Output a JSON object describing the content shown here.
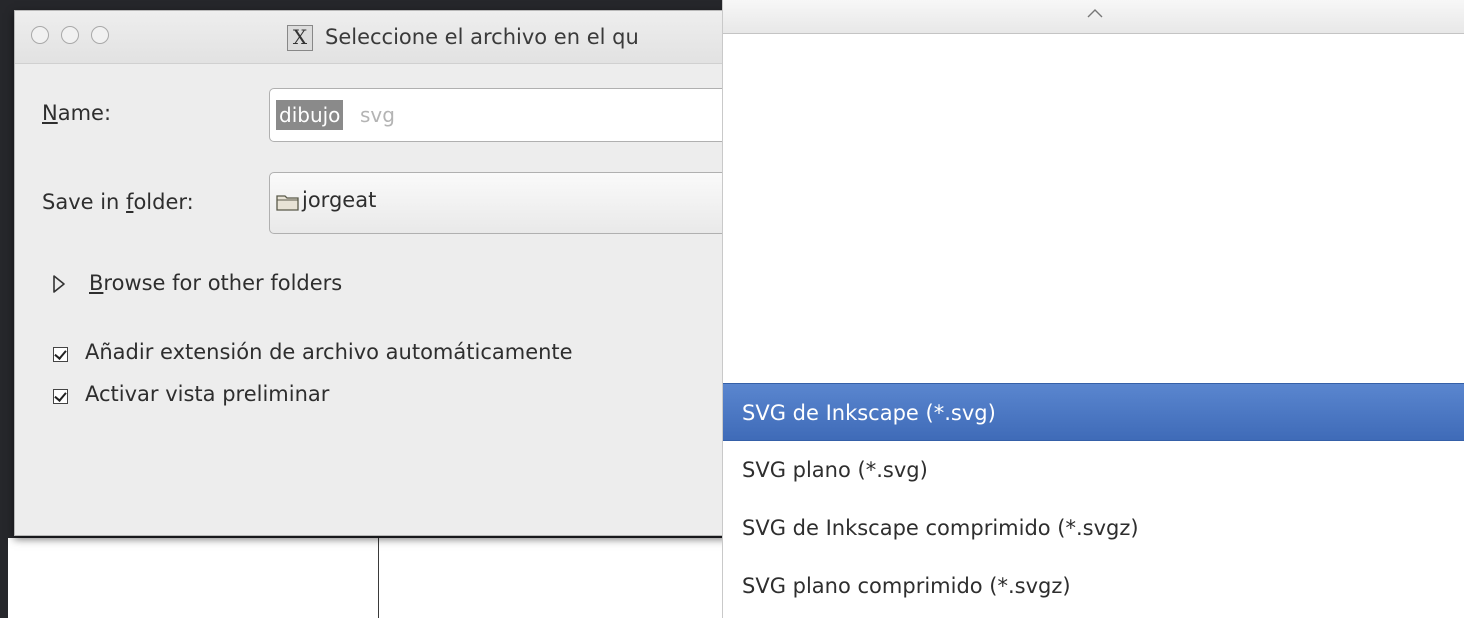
{
  "dialog": {
    "title": "Seleccione el archivo en el qu",
    "title_icon": "x-window-icon",
    "name_label_underline": "N",
    "name_label_rest": "ame:",
    "name_value_selected": "dibujo",
    "name_value_rest": "svg",
    "folder_label_prefix": "Save in ",
    "folder_label_underline": "f",
    "folder_label_suffix": "older:",
    "folder_value": "jorgeat",
    "browse_underline": "B",
    "browse_rest": "rowse for other folders",
    "checkbox_extension": {
      "label": "Añadir extensión de archivo automáticamente",
      "checked": true
    },
    "checkbox_preview": {
      "label": "Activar vista preliminar",
      "checked": true
    }
  },
  "filetype_menu": {
    "items": [
      {
        "label": "SVG de Inkscape (*.svg)",
        "selected": true
      },
      {
        "label": "SVG plano (*.svg)",
        "selected": false
      },
      {
        "label": "SVG de Inkscape comprimido (*.svgz)",
        "selected": false
      },
      {
        "label": "SVG plano comprimido (*.svgz)",
        "selected": false
      }
    ]
  },
  "colors": {
    "selection": "#4a77c4",
    "dialog_bg": "#ededed",
    "desktop_bg": "#26272b"
  }
}
